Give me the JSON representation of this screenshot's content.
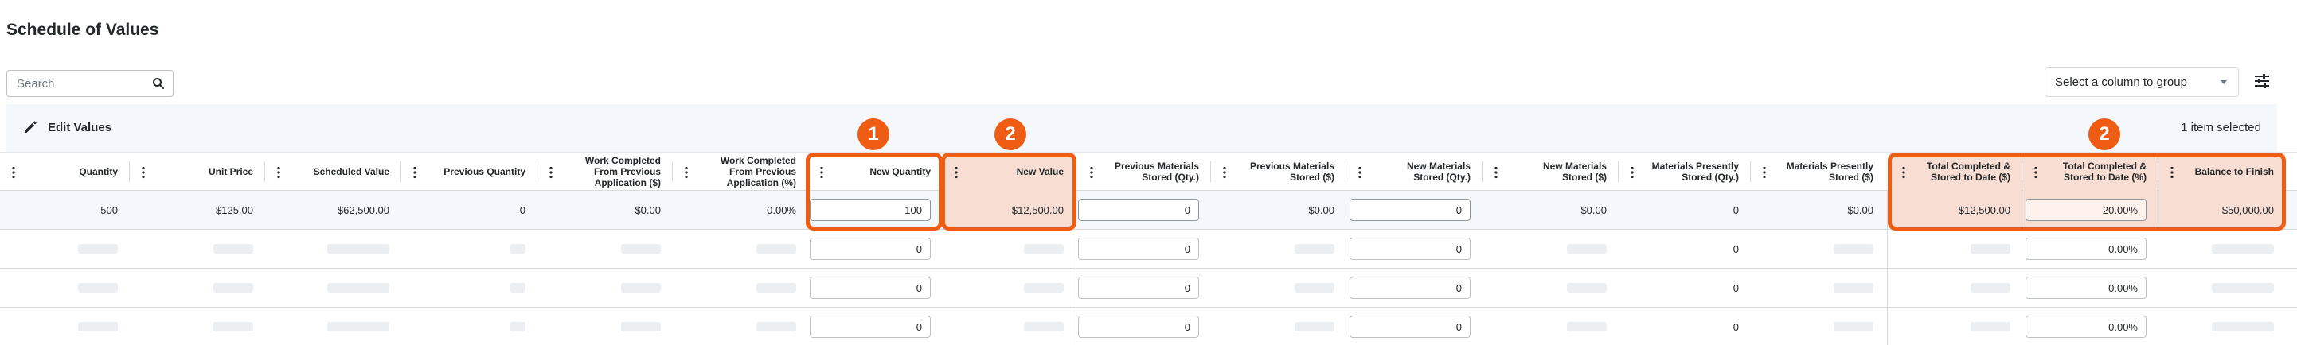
{
  "page": {
    "title": "Schedule of Values"
  },
  "search": {
    "placeholder": "Search"
  },
  "toolbar": {
    "group_select": "Select a column to group",
    "edit_values": "Edit Values",
    "selected_count": "1 item selected"
  },
  "columns": [
    "Quantity",
    "Unit Price",
    "Scheduled Value",
    "Previous Quantity",
    "Work Completed From Previous Application ($)",
    "Work Completed From Previous Application (%)",
    "New Quantity",
    "New Value",
    "Previous Materials Stored (Qty.)",
    "Previous Materials Stored ($)",
    "New Materials Stored (Qty.)",
    "New Materials Stored ($)",
    "Materials Presently Stored (Qty.)",
    "Materials Presently Stored ($)",
    "Total Completed & Stored to Date ($)",
    "Total Completed & Stored to Date (%)",
    "Balance to Finish"
  ],
  "rows": [
    {
      "quantity": "500",
      "unit_price": "$125.00",
      "scheduled_value": "$62,500.00",
      "previous_quantity": "0",
      "work_prev_amount": "$0.00",
      "work_prev_percent": "0.00%",
      "new_quantity": "100",
      "new_value": "$12,500.00",
      "prev_materials_qty": "0",
      "prev_materials_amount": "$0.00",
      "new_materials_qty": "0",
      "new_materials_amount": "$0.00",
      "materials_present_qty": "0",
      "materials_present_amount": "$0.00",
      "total_completed_amount": "$12,500.00",
      "total_completed_percent": "20.00%",
      "balance_to_finish": "$50,000.00"
    },
    {
      "new_quantity": "0",
      "prev_materials_qty": "0",
      "new_materials_qty": "0",
      "materials_present_qty": "0",
      "total_completed_percent": "0.00%"
    },
    {
      "new_quantity": "0",
      "prev_materials_qty": "0",
      "new_materials_qty": "0",
      "materials_present_qty": "0",
      "total_completed_percent": "0.00%"
    },
    {
      "new_quantity": "0",
      "prev_materials_qty": "0",
      "new_materials_qty": "0",
      "materials_present_qty": "0",
      "total_completed_percent": "0.00%"
    }
  ],
  "callouts": {
    "first": "1",
    "second": "2",
    "third": "2"
  },
  "colors": {
    "accent": "#ee5d13",
    "highlight": "#f7ddd2",
    "selected_row": "#f4f7fb"
  }
}
